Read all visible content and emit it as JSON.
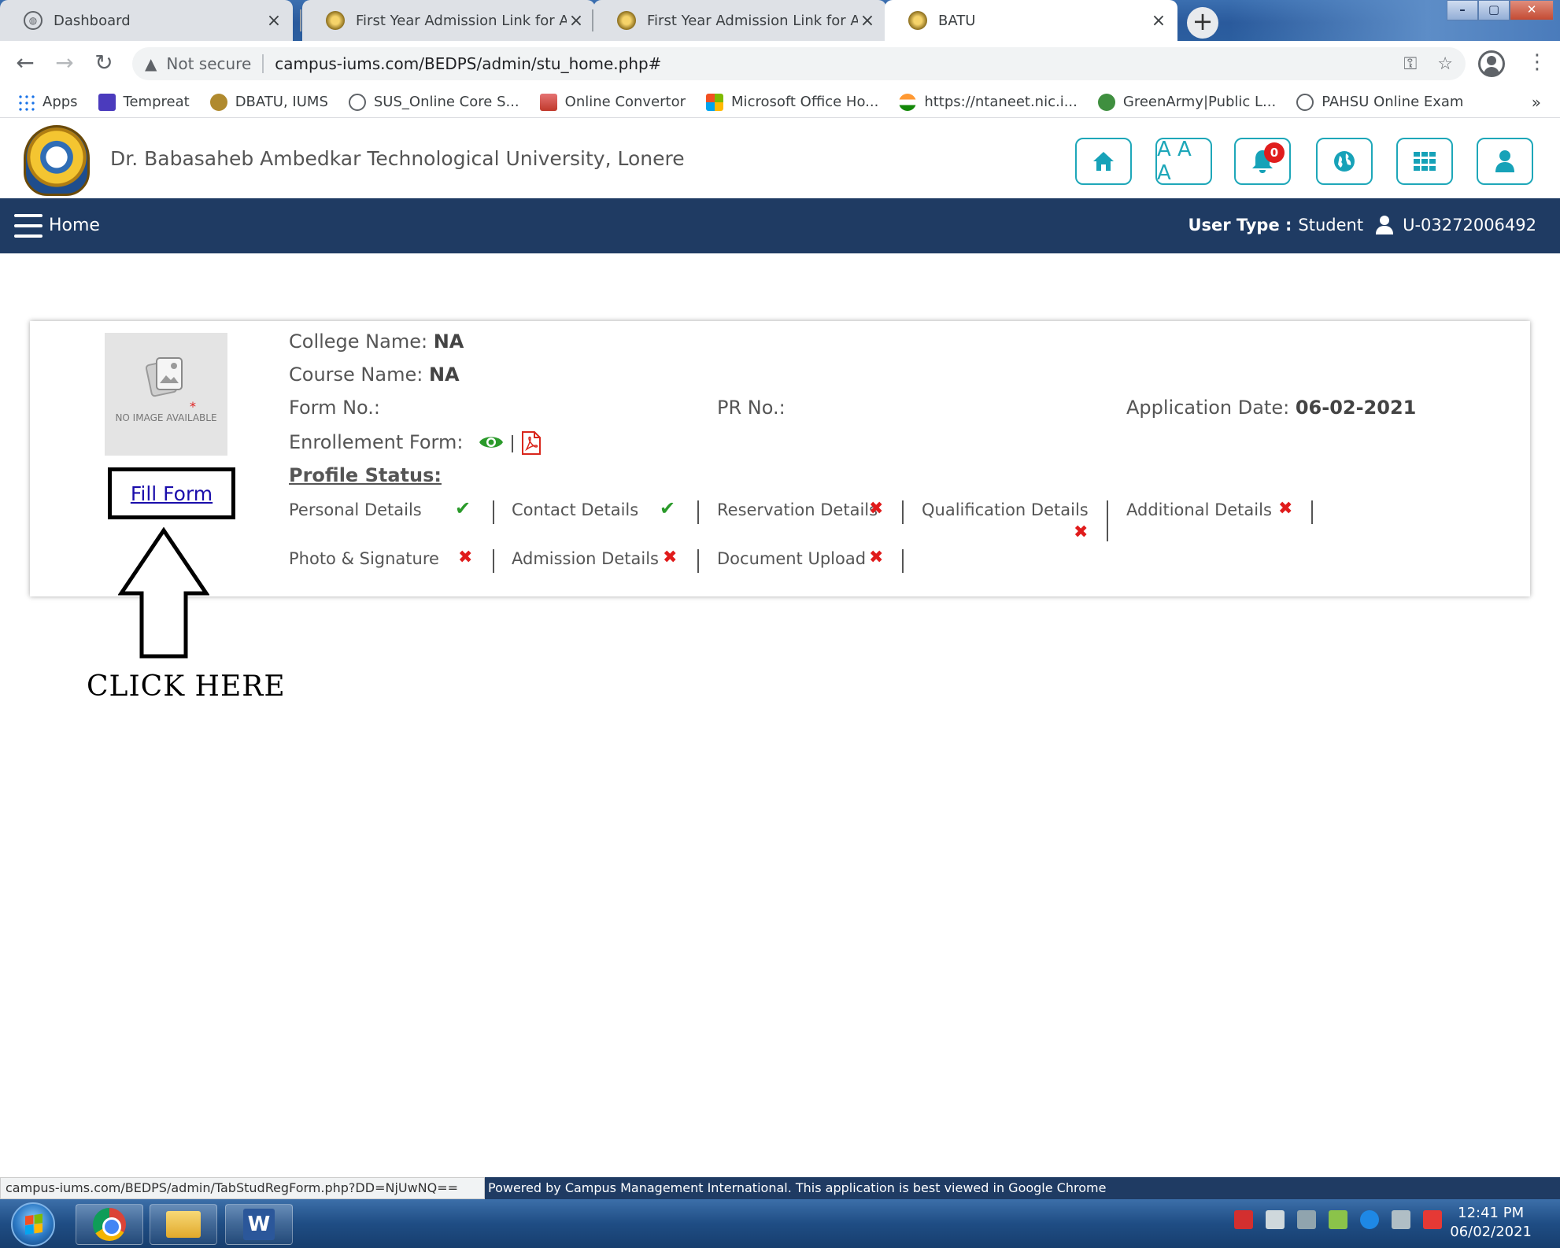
{
  "browser": {
    "tabs": [
      {
        "title": "Dashboard",
        "icon": "globe-icon",
        "active": false
      },
      {
        "title": "First Year Admission Link for All C",
        "icon": "university-seal-icon",
        "active": false
      },
      {
        "title": "First Year Admission Link for All C",
        "icon": "university-seal-icon",
        "active": false
      },
      {
        "title": "BATU",
        "icon": "university-seal-icon",
        "active": true
      }
    ],
    "new_tab": "+",
    "window_buttons": {
      "minimize": "–",
      "maximize": "▢",
      "close": "✕"
    },
    "security_label": "Not secure",
    "url": "campus-iums.com/BEDPS/admin/stu_home.php#",
    "bookmarks": [
      {
        "label": "Apps",
        "color": "#1a73e8"
      },
      {
        "label": "Tempreat",
        "color": "#4b3bbd"
      },
      {
        "label": "DBATU, IUMS",
        "color": "#b08a2e"
      },
      {
        "label": "SUS_Online Core S...",
        "color": "#5f6368"
      },
      {
        "label": "Online Convertor",
        "color": "#c0392b"
      },
      {
        "label": "Microsoft Office Ho...",
        "color": "#f25022"
      },
      {
        "label": "https://ntaneet.nic.i...",
        "color": "#e67e22"
      },
      {
        "label": "GreenArmy|Public L...",
        "color": "#3f8f3f"
      },
      {
        "label": "PAHSU Online Exam",
        "color": "#5f6368"
      }
    ],
    "bookmarks_more": "»"
  },
  "site": {
    "title": "Dr. Babasaheb Ambedkar Technological University, Lonere",
    "font_size_label": "A A A",
    "notification_count": "0",
    "accent_color": "#17a2b8"
  },
  "nav": {
    "home": "Home",
    "user_type_label": "User Type :",
    "user_type_value": "Student",
    "user_id": "U-03272006492"
  },
  "profile": {
    "no_image": "NO IMAGE AVAILABLE",
    "required_star": "*",
    "fill_form": "Fill Form",
    "college_label": "College Name:",
    "college_value": "NA",
    "course_label": "Course Name:",
    "course_value": "NA",
    "form_no_label": "Form No.:",
    "pr_no_label": "PR No.:",
    "application_date_label": "Application Date:",
    "application_date_value": "06-02-2021",
    "enrollment_label": "Enrollement Form:",
    "status_heading": "Profile Status:",
    "status_items": [
      {
        "label": "Personal Details",
        "done": true
      },
      {
        "label": "Contact Details",
        "done": true
      },
      {
        "label": "Reservation Details",
        "done": false
      },
      {
        "label": "Qualification Details",
        "done": false
      },
      {
        "label": "Additional Details",
        "done": false
      },
      {
        "label": "Photo & Signature",
        "done": false
      },
      {
        "label": "Admission Details",
        "done": false
      },
      {
        "label": "Document Upload",
        "done": false
      }
    ],
    "check_mark": "✔",
    "cross_mark": "✖"
  },
  "annotation": {
    "text": "CLICK HERE"
  },
  "status_bar": {
    "link_url": "campus-iums.com/BEDPS/admin/TabStudRegForm.php?DD=NjUwNQ==",
    "footer": "Powered by Campus Management International. This application is best viewed in Google Chrome"
  },
  "taskbar": {
    "time": "12:41 PM",
    "date": "06/02/2021",
    "word_icon_letter": "W"
  }
}
